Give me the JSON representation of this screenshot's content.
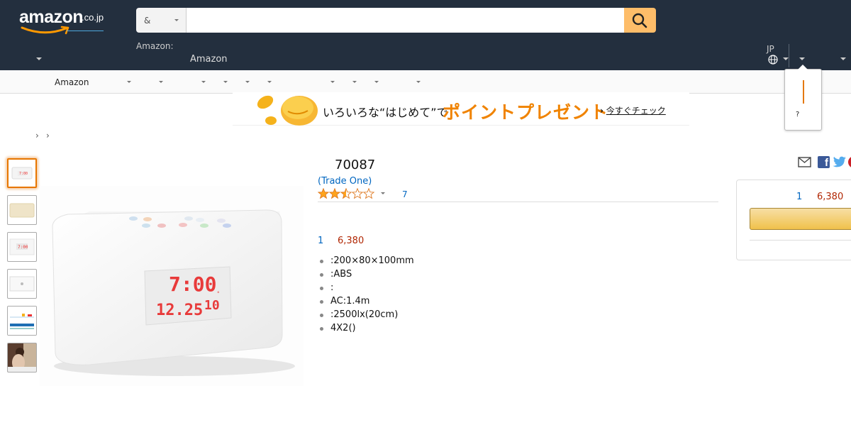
{
  "header": {
    "logo_text": "amazon",
    "logo_suffix": ".co.jp",
    "search_category": "&",
    "search_placeholder": "",
    "deliver_label": "Amazon:",
    "deliver_value": "Amazon",
    "language": "JP"
  },
  "subnav": {
    "first_item": "Amazon"
  },
  "flyout": {
    "question": "?"
  },
  "banner": {
    "text1": "いろいろな“はじめて”で",
    "text2": "ポイントプレゼント",
    "text3_arrow": "›",
    "text3_link": "今すぐチェック",
    "colors": {
      "highlight": "#f08300"
    }
  },
  "breadcrumb": [
    "›",
    "›"
  ],
  "product": {
    "title": "70087",
    "brand": "(Trade One)",
    "rating": 2.5,
    "rating_max": 5,
    "review_count": "7",
    "offer_qty": "1",
    "offer_price": "6,380",
    "bullets": [
      ":200×80×100mm",
      ":ABS",
      ":",
      "AC:1.4m",
      ":2500lx(20cm)",
      "4X2()"
    ],
    "clock_time": "7:00",
    "clock_date": "12.25",
    "clock_temp": "10"
  },
  "buybox": {
    "qty": "1",
    "price": "6,380"
  },
  "colors": {
    "header_bg": "#232f3e",
    "search_button": "#febd69",
    "link": "#0066c0",
    "price": "#b12704",
    "active_thumb": "#e77600"
  }
}
